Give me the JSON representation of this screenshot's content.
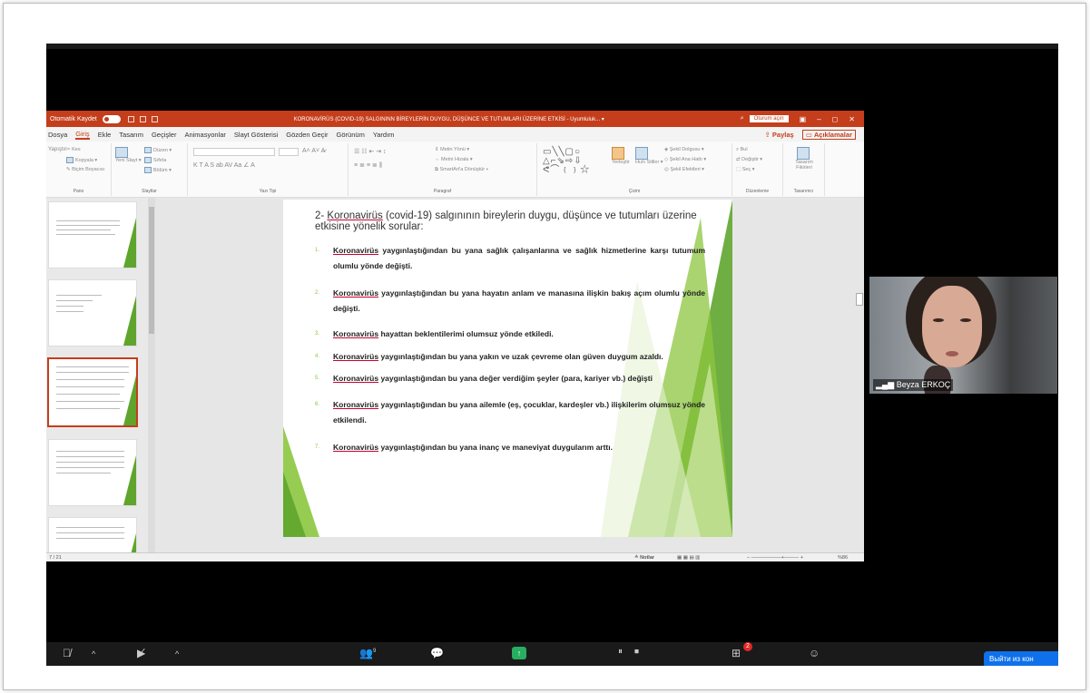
{
  "ppt": {
    "autosave": "Otomatik Kaydet",
    "title": "KORONAVİRÜS (COVID-19) SALGININN BİREYLERİN DUYGU, DÜŞÜNCE VE TUTUMLARI ÜZERİNE ETKİSİ - Uyumluluk... ▾",
    "share_screen": "Oturum açın",
    "tabs": [
      "Dosya",
      "Giriş",
      "Ekle",
      "Tasarım",
      "Geçişler",
      "Animasyonlar",
      "Slayt Gösterisi",
      "Gözden Geçir",
      "Görünüm",
      "Yardım"
    ],
    "active_tab": "Giriş",
    "share": "Paylaş",
    "comments": "Açıklamalar",
    "ribbon": {
      "cut": "Kes",
      "copy": "Kopyala ▾",
      "format_painter": "Biçim Boyacısı",
      "paste": "Yapıştır",
      "new_slide": "Yeni Slayt ▾",
      "layout": "Düzen ▾",
      "reset": "Sıfırla",
      "section": "Bölüm ▾",
      "groups": [
        "Pano",
        "Slaytlar",
        "Yazı Tipi",
        "Paragraf",
        "Çizim",
        "Düzenleme",
        "Tasarımcı"
      ],
      "text_dir": "Metin Yönü ▾",
      "align_text": "Metni Hizala ▾",
      "smartart": "SmartArt'a Dönüştür ▾",
      "arrange": "Yerleştir",
      "quick_styles": "Hızlı Stiller ▾",
      "shape_fill": "Şekil Dolgusu ▾",
      "shape_outline": "Şekil Ana Hattı ▾",
      "shape_effects": "Şekil Efektleri ▾",
      "find": "Bul",
      "replace": "Değiştir ▾",
      "select": "Seç ▾",
      "design_ideas": "Tasarım Fikirleri"
    },
    "status_slide": "7 / 21",
    "notes": "Notlar",
    "zoom": "%86"
  },
  "slide": {
    "title_prefix": "2- ",
    "title_word": "Koronavirüs",
    "title_rest": " (covid-19) salgınının bireylerin duygu, düşünce ve tutumları üzerine etkisine yönelik sorular:",
    "items": [
      {
        "num": "1.",
        "word": "Koronavirüs",
        "text": " yaygınlaştığından bu yana sağlık çalışanlarına ve sağlık hizmetlerine karşı tutumum olumlu yönde değişti."
      },
      {
        "num": "2.",
        "word": "Koronavirüs",
        "text": " yaygınlaştığından bu yana hayatın anlam ve manasına ilişkin bakış açım olumlu yönde değişti."
      },
      {
        "num": "3.",
        "word": "Koronavirüs",
        "text": " hayattan beklentilerimi olumsuz yönde etkiledi."
      },
      {
        "num": "4.",
        "word": "Koronavirüs",
        "text": " yaygınlaştığından bu yana yakın ve uzak çevreme olan güven duygum azaldı."
      },
      {
        "num": "5.",
        "word": "Koronavirüs",
        "text": " yaygınlaştığından bu yana değer verdiğim şeyler (para, kariyer vb.) değişti"
      },
      {
        "num": "6.",
        "word": "Koronavirüs",
        "text": " yaygınlaştığından bu yana ailemle (eş, çocuklar, kardeşler vb.) ilişkilerim olumsuz yönde etkilendi."
      },
      {
        "num": "7.",
        "word": "Koronavirüs",
        "text": " yaygınlaştığından bu yana inanç ve maneviyat duygularım arttı."
      }
    ]
  },
  "participant": {
    "name": "Beyza ERKOÇ"
  },
  "zoom_toolbar": {
    "participants_count": "9",
    "apps_badge": "2",
    "leave": "Выйти из кон"
  },
  "colors": {
    "ppt_accent": "#c43e1c",
    "slide_green": "#8cc63f",
    "zoom_blue": "#0e71eb"
  }
}
